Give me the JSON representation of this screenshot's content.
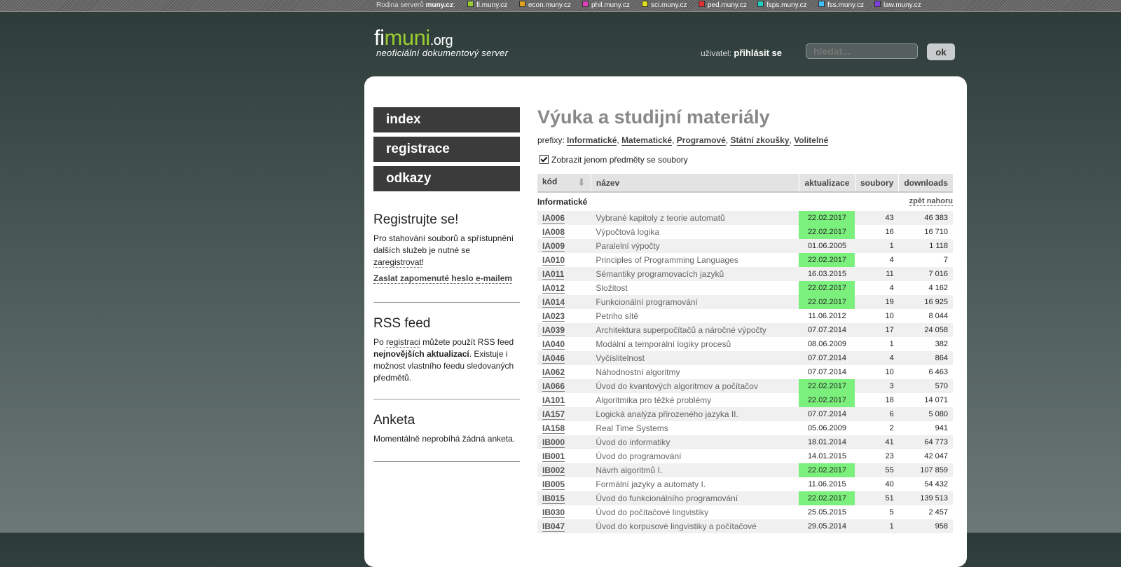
{
  "topbar": {
    "family_label": "Rodina serverů",
    "family_brand": "muny.cz",
    "servers": [
      {
        "label": "fi.muny.cz",
        "color": "#9acd32"
      },
      {
        "label": "econ.muny.cz",
        "color": "#e0a020"
      },
      {
        "label": "phil.muny.cz",
        "color": "#e040c0"
      },
      {
        "label": "sci.muny.cz",
        "color": "#e0e020"
      },
      {
        "label": "ped.muny.cz",
        "color": "#e03030"
      },
      {
        "label": "fsps.muny.cz",
        "color": "#20d0c0"
      },
      {
        "label": "fss.muny.cz",
        "color": "#40c0ff"
      },
      {
        "label": "law.muny.cz",
        "color": "#8040e0"
      }
    ]
  },
  "header": {
    "logo_fi": "fi",
    "logo_muni": "muni",
    "logo_org": ".org",
    "tagline": "neoficiální dokumentový server",
    "user_label": "uživatel:",
    "login_link": "přihlásit se",
    "search_placeholder": "hledat...",
    "search_button": "ok"
  },
  "nav": [
    "index",
    "registrace",
    "odkazy"
  ],
  "sidebar": {
    "register_heading": "Registrujte se!",
    "register_text_1": "Pro stahování souborů a spřístupnění dalších služeb je nutné se",
    "register_link": "zaregistrovat",
    "register_text_2": "!",
    "forgot_link": "Zaslat zapomenuté heslo e-mailem",
    "rss_heading": "RSS feed",
    "rss_text_1": "Po",
    "rss_link": "registraci",
    "rss_text_2": "můžete použít RSS feed",
    "rss_bold": "nejnovějších aktualizací",
    "rss_text_3": ". Existuje i možnost vlastního feedu sledovaných předmětů.",
    "poll_heading": "Anketa",
    "poll_text": "Momentálně neprobíhá žádná anketa."
  },
  "main": {
    "title": "Výuka a studijní materiály",
    "prefix_label": "prefixy:",
    "prefixes": [
      "Informatické",
      "Matematické",
      "Programové",
      "Státní zkoušky",
      "Volitelné"
    ],
    "checkbox_label": "Zobrazit jenom předměty se soubory",
    "columns": {
      "code": "kód",
      "name": "název",
      "updated": "aktualizace",
      "files": "soubory",
      "downloads": "downloads"
    },
    "section": "Informatické",
    "back_to_top": "zpět nahoru",
    "rows": [
      {
        "code": "IA006",
        "name": "Vybrané kapitoly z teorie automatů",
        "date": "22.02.2017",
        "fresh": true,
        "files": "43",
        "downloads": "46 383"
      },
      {
        "code": "IA008",
        "name": "Výpočtová logika",
        "date": "22.02.2017",
        "fresh": true,
        "files": "16",
        "downloads": "16 710"
      },
      {
        "code": "IA009",
        "name": "Paralelní výpočty",
        "date": "01.06.2005",
        "fresh": false,
        "files": "1",
        "downloads": "1 118"
      },
      {
        "code": "IA010",
        "name": "Principles of Programming Languages",
        "date": "22.02.2017",
        "fresh": true,
        "files": "4",
        "downloads": "7"
      },
      {
        "code": "IA011",
        "name": "Sémantiky programovacích jazyků",
        "date": "16.03.2015",
        "fresh": false,
        "files": "11",
        "downloads": "7 016"
      },
      {
        "code": "IA012",
        "name": "Složitost",
        "date": "22.02.2017",
        "fresh": true,
        "files": "4",
        "downloads": "4 162"
      },
      {
        "code": "IA014",
        "name": "Funkcionální programování",
        "date": "22.02.2017",
        "fresh": true,
        "files": "19",
        "downloads": "16 925"
      },
      {
        "code": "IA023",
        "name": "Petriho sítě",
        "date": "11.06.2012",
        "fresh": false,
        "files": "10",
        "downloads": "8 044"
      },
      {
        "code": "IA039",
        "name": "Architektura superpočítačů a náročné výpočty",
        "date": "07.07.2014",
        "fresh": false,
        "files": "17",
        "downloads": "24 058"
      },
      {
        "code": "IA040",
        "name": "Modální a temporální logiky procesů",
        "date": "08.06.2009",
        "fresh": false,
        "files": "1",
        "downloads": "382"
      },
      {
        "code": "IA046",
        "name": "Vyčíslitelnost",
        "date": "07.07.2014",
        "fresh": false,
        "files": "4",
        "downloads": "864"
      },
      {
        "code": "IA062",
        "name": "Náhodnostní algoritmy",
        "date": "07.07.2014",
        "fresh": false,
        "files": "10",
        "downloads": "6 463"
      },
      {
        "code": "IA066",
        "name": "Úvod do kvantových algoritmov a počítačov",
        "date": "22.02.2017",
        "fresh": true,
        "files": "3",
        "downloads": "570"
      },
      {
        "code": "IA101",
        "name": "Algoritmika pro těžké problémy",
        "date": "22.02.2017",
        "fresh": true,
        "files": "18",
        "downloads": "14 071"
      },
      {
        "code": "IA157",
        "name": "Logická analýza přirozeného jazyka II.",
        "date": "07.07.2014",
        "fresh": false,
        "files": "6",
        "downloads": "5 080"
      },
      {
        "code": "IA158",
        "name": "Real Time Systems",
        "date": "05.06.2009",
        "fresh": false,
        "files": "2",
        "downloads": "941"
      },
      {
        "code": "IB000",
        "name": "Úvod do informatiky",
        "date": "18.01.2014",
        "fresh": false,
        "files": "41",
        "downloads": "64 773"
      },
      {
        "code": "IB001",
        "name": "Úvod do programování",
        "date": "14.01.2015",
        "fresh": false,
        "files": "23",
        "downloads": "42 047"
      },
      {
        "code": "IB002",
        "name": "Návrh algoritmů I.",
        "date": "22.02.2017",
        "fresh": true,
        "files": "55",
        "downloads": "107 859"
      },
      {
        "code": "IB005",
        "name": "Formální jazyky a automaty I.",
        "date": "11.06.2015",
        "fresh": false,
        "files": "40",
        "downloads": "54 432"
      },
      {
        "code": "IB015",
        "name": "Úvod do funkcionálního programování",
        "date": "22.02.2017",
        "fresh": true,
        "files": "51",
        "downloads": "139 513"
      },
      {
        "code": "IB030",
        "name": "Úvod do počítačové lingvistiky",
        "date": "25.05.2015",
        "fresh": false,
        "files": "5",
        "downloads": "2 457"
      },
      {
        "code": "IB047",
        "name": "Úvod do korpusové lingvistiky a počítačové",
        "date": "29.05.2014",
        "fresh": false,
        "files": "1",
        "downloads": "958"
      }
    ]
  }
}
